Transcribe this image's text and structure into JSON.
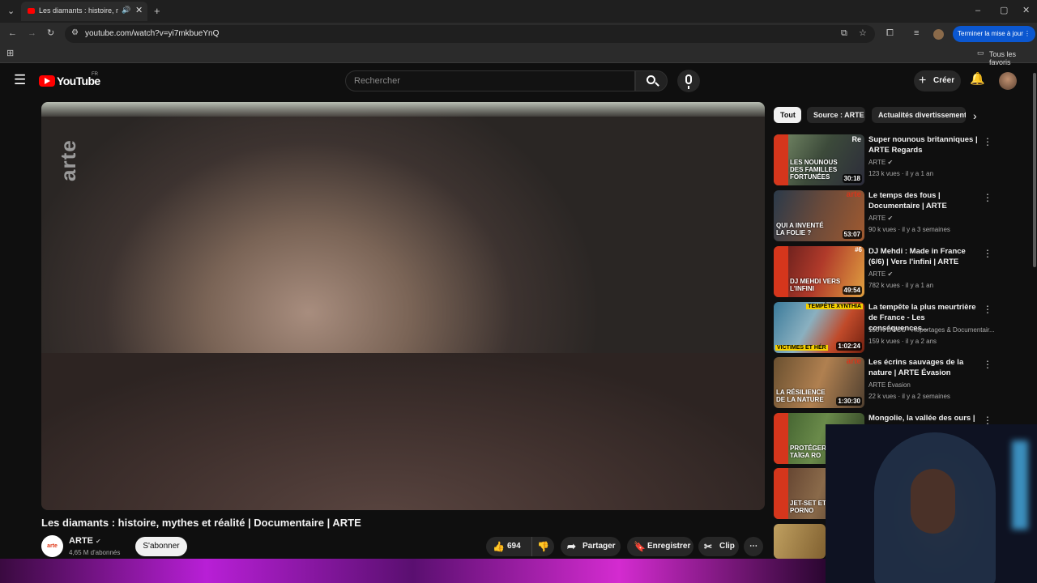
{
  "browser": {
    "tab_title": "Les diamants : histoire, myth",
    "url": "youtube.com/watch?v=yi7mkbueYnQ",
    "update_button": "Terminer la mise à jour",
    "bookmarks_all": "Tous les favoris"
  },
  "youtube": {
    "logo": "YouTube",
    "region": "FR",
    "search_placeholder": "Rechercher",
    "create_label": "Créer"
  },
  "video": {
    "title": "Les diamants : histoire, mythes et réalité | Documentaire | ARTE",
    "watermark": "arte",
    "channel": "ARTE",
    "channel_avatar_text": "arte",
    "subscribers": "4,65 M d'abonnés",
    "subscribe": "S'abonner",
    "likes": "694",
    "share": "Partager",
    "save": "Enregistrer",
    "clip": "Clip"
  },
  "chips": [
    "Tout",
    "Source : ARTE",
    "Actualités divertissement"
  ],
  "recommendations": [
    {
      "title": "Super nounous britanniques | ARTE Regards",
      "channel": "ARTE",
      "meta": "123 k vues · il y a 1 an",
      "duration": "30:18",
      "caption": "LES NOUNOUS DES FAMILLES FORTUNÉES",
      "tag": "Re"
    },
    {
      "title": "Le temps des fous | Documentaire | ARTE",
      "channel": "ARTE",
      "meta": "90 k vues · il y a 3 semaines",
      "duration": "53:07",
      "caption": "QUI A INVENTÉ LA FOLIE ?",
      "tag": "arte"
    },
    {
      "title": "DJ Mehdi : Made in France (6/6) | Vers l'infini | ARTE",
      "channel": "ARTE",
      "meta": "782 k vues · il y a 1 an",
      "duration": "49:54",
      "caption": "DJ MEHDI VERS L'INFINI",
      "tag": "#6"
    },
    {
      "title": "La tempête la plus meurtrière de France - Les conséquences...",
      "channel": "100% DOCS - Reportages & Documentair...",
      "meta": "159 k vues · il y a 2 ans",
      "duration": "1:02:24",
      "caption": "VICTIMES ET HÉR",
      "tag": "TEMPÊTE XYNTHIA"
    },
    {
      "title": "Les écrins sauvages de la nature | ARTE Évasion",
      "channel": "ARTE Évasion",
      "meta": "22 k vues · il y a 2 semaines",
      "duration": "1:30:30",
      "caption": "LA RÉSILIENCE DE LA NATURE",
      "tag": "arte"
    },
    {
      "title": "Mongolie, la vallée des ours |",
      "channel": "",
      "meta": "",
      "duration": "",
      "caption": "PROTÉGER TAÏGA RO",
      "tag": ""
    },
    {
      "title": "",
      "channel": "",
      "meta": "",
      "duration": "",
      "caption": "JET-SET ET PORNO",
      "tag": ""
    }
  ],
  "colors": {
    "arte_red": "#d5361c",
    "yt_red": "#ff0000",
    "background": "#0f0f0f",
    "update_button": "#0b57d0"
  }
}
